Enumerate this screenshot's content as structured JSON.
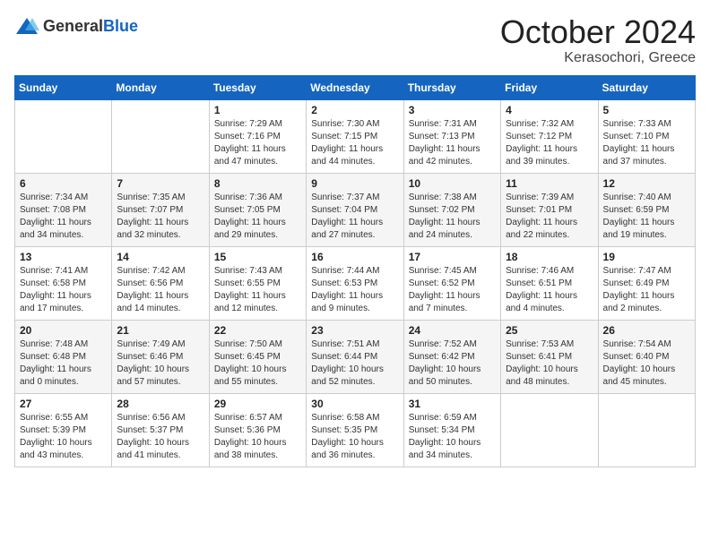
{
  "header": {
    "logo_general": "General",
    "logo_blue": "Blue",
    "month": "October 2024",
    "location": "Kerasochori, Greece"
  },
  "days_of_week": [
    "Sunday",
    "Monday",
    "Tuesday",
    "Wednesday",
    "Thursday",
    "Friday",
    "Saturday"
  ],
  "weeks": [
    [
      {
        "day": "",
        "info": ""
      },
      {
        "day": "",
        "info": ""
      },
      {
        "day": "1",
        "info": "Sunrise: 7:29 AM\nSunset: 7:16 PM\nDaylight: 11 hours and 47 minutes."
      },
      {
        "day": "2",
        "info": "Sunrise: 7:30 AM\nSunset: 7:15 PM\nDaylight: 11 hours and 44 minutes."
      },
      {
        "day": "3",
        "info": "Sunrise: 7:31 AM\nSunset: 7:13 PM\nDaylight: 11 hours and 42 minutes."
      },
      {
        "day": "4",
        "info": "Sunrise: 7:32 AM\nSunset: 7:12 PM\nDaylight: 11 hours and 39 minutes."
      },
      {
        "day": "5",
        "info": "Sunrise: 7:33 AM\nSunset: 7:10 PM\nDaylight: 11 hours and 37 minutes."
      }
    ],
    [
      {
        "day": "6",
        "info": "Sunrise: 7:34 AM\nSunset: 7:08 PM\nDaylight: 11 hours and 34 minutes."
      },
      {
        "day": "7",
        "info": "Sunrise: 7:35 AM\nSunset: 7:07 PM\nDaylight: 11 hours and 32 minutes."
      },
      {
        "day": "8",
        "info": "Sunrise: 7:36 AM\nSunset: 7:05 PM\nDaylight: 11 hours and 29 minutes."
      },
      {
        "day": "9",
        "info": "Sunrise: 7:37 AM\nSunset: 7:04 PM\nDaylight: 11 hours and 27 minutes."
      },
      {
        "day": "10",
        "info": "Sunrise: 7:38 AM\nSunset: 7:02 PM\nDaylight: 11 hours and 24 minutes."
      },
      {
        "day": "11",
        "info": "Sunrise: 7:39 AM\nSunset: 7:01 PM\nDaylight: 11 hours and 22 minutes."
      },
      {
        "day": "12",
        "info": "Sunrise: 7:40 AM\nSunset: 6:59 PM\nDaylight: 11 hours and 19 minutes."
      }
    ],
    [
      {
        "day": "13",
        "info": "Sunrise: 7:41 AM\nSunset: 6:58 PM\nDaylight: 11 hours and 17 minutes."
      },
      {
        "day": "14",
        "info": "Sunrise: 7:42 AM\nSunset: 6:56 PM\nDaylight: 11 hours and 14 minutes."
      },
      {
        "day": "15",
        "info": "Sunrise: 7:43 AM\nSunset: 6:55 PM\nDaylight: 11 hours and 12 minutes."
      },
      {
        "day": "16",
        "info": "Sunrise: 7:44 AM\nSunset: 6:53 PM\nDaylight: 11 hours and 9 minutes."
      },
      {
        "day": "17",
        "info": "Sunrise: 7:45 AM\nSunset: 6:52 PM\nDaylight: 11 hours and 7 minutes."
      },
      {
        "day": "18",
        "info": "Sunrise: 7:46 AM\nSunset: 6:51 PM\nDaylight: 11 hours and 4 minutes."
      },
      {
        "day": "19",
        "info": "Sunrise: 7:47 AM\nSunset: 6:49 PM\nDaylight: 11 hours and 2 minutes."
      }
    ],
    [
      {
        "day": "20",
        "info": "Sunrise: 7:48 AM\nSunset: 6:48 PM\nDaylight: 11 hours and 0 minutes."
      },
      {
        "day": "21",
        "info": "Sunrise: 7:49 AM\nSunset: 6:46 PM\nDaylight: 10 hours and 57 minutes."
      },
      {
        "day": "22",
        "info": "Sunrise: 7:50 AM\nSunset: 6:45 PM\nDaylight: 10 hours and 55 minutes."
      },
      {
        "day": "23",
        "info": "Sunrise: 7:51 AM\nSunset: 6:44 PM\nDaylight: 10 hours and 52 minutes."
      },
      {
        "day": "24",
        "info": "Sunrise: 7:52 AM\nSunset: 6:42 PM\nDaylight: 10 hours and 50 minutes."
      },
      {
        "day": "25",
        "info": "Sunrise: 7:53 AM\nSunset: 6:41 PM\nDaylight: 10 hours and 48 minutes."
      },
      {
        "day": "26",
        "info": "Sunrise: 7:54 AM\nSunset: 6:40 PM\nDaylight: 10 hours and 45 minutes."
      }
    ],
    [
      {
        "day": "27",
        "info": "Sunrise: 6:55 AM\nSunset: 5:39 PM\nDaylight: 10 hours and 43 minutes."
      },
      {
        "day": "28",
        "info": "Sunrise: 6:56 AM\nSunset: 5:37 PM\nDaylight: 10 hours and 41 minutes."
      },
      {
        "day": "29",
        "info": "Sunrise: 6:57 AM\nSunset: 5:36 PM\nDaylight: 10 hours and 38 minutes."
      },
      {
        "day": "30",
        "info": "Sunrise: 6:58 AM\nSunset: 5:35 PM\nDaylight: 10 hours and 36 minutes."
      },
      {
        "day": "31",
        "info": "Sunrise: 6:59 AM\nSunset: 5:34 PM\nDaylight: 10 hours and 34 minutes."
      },
      {
        "day": "",
        "info": ""
      },
      {
        "day": "",
        "info": ""
      }
    ]
  ]
}
